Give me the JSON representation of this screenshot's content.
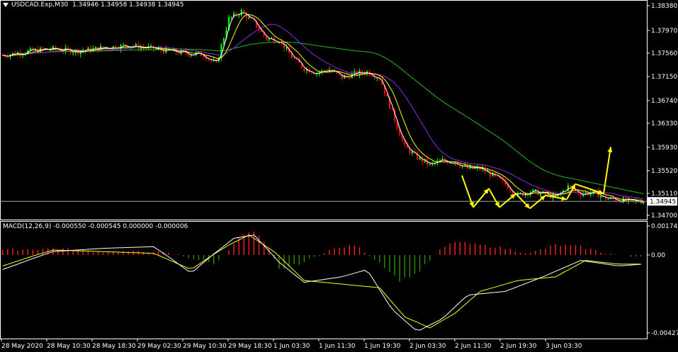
{
  "header": {
    "symbol": "USDCAD.Exp,M30",
    "ohlc": "1.34946 1.34958 1.34938 1.34945"
  },
  "macd_header": "MACD(12,26,9) -0.000550 -0.000545 0.000000 -0.000006",
  "colors": {
    "background": "#000000",
    "bull_candle": "#00ff00",
    "bear_candle": "#ff0000",
    "ma_fast": "#ffff00",
    "ma_mid": "#8a2be2",
    "ma_slow": "#22b822",
    "macd_pos": "#ff2020",
    "macd_neg": "#2e8b00",
    "signal": "#ffff00",
    "macd_line": "#ffffff",
    "arrows": "#ffff00",
    "grid": "#ffffff"
  },
  "chart_data": [
    {
      "type": "candlestick",
      "title": "USDCAD.Exp,M30",
      "y_ticks": [
        "1.38380",
        "1.37970",
        "1.37560",
        "1.37150",
        "1.36740",
        "1.36330",
        "1.35930",
        "1.35520",
        "1.35110",
        "1.34700"
      ],
      "ylim": [
        1.347,
        1.3838
      ],
      "current_price": "1.34945",
      "x_ticks": [
        "28 May 2020",
        "28 May 10:30",
        "28 May 18:30",
        "29 May 02:30",
        "29 May 10:30",
        "29 May 18:30",
        "1 Jun 03:30",
        "1 Jun 11:30",
        "1 Jun 19:30",
        "2 Jun 03:30",
        "2 Jun 11:30",
        "2 Jun 19:30",
        "3 Jun 03:30"
      ],
      "price_path": [
        [
          0,
          1.3751
        ],
        [
          10,
          1.3758
        ],
        [
          20,
          1.3762
        ],
        [
          30,
          1.3758
        ],
        [
          40,
          1.3764
        ],
        [
          50,
          1.3768
        ],
        [
          60,
          1.3762
        ],
        [
          70,
          1.3756
        ],
        [
          80,
          1.3752
        ],
        [
          85,
          1.3735
        ],
        [
          90,
          1.3815
        ],
        [
          95,
          1.3828
        ],
        [
          100,
          1.3808
        ],
        [
          105,
          1.378
        ],
        [
          110,
          1.3778
        ],
        [
          115,
          1.3748
        ],
        [
          120,
          1.3728
        ],
        [
          125,
          1.372
        ],
        [
          130,
          1.3726
        ],
        [
          135,
          1.3712
        ],
        [
          140,
          1.3718
        ],
        [
          145,
          1.3722
        ],
        [
          150,
          1.3712
        ],
        [
          155,
          1.365
        ],
        [
          160,
          1.359
        ],
        [
          165,
          1.3572
        ],
        [
          170,
          1.3558
        ],
        [
          175,
          1.3566
        ],
        [
          180,
          1.3564
        ],
        [
          185,
          1.3552
        ],
        [
          190,
          1.3552
        ],
        [
          195,
          1.354
        ],
        [
          200,
          1.3525
        ],
        [
          205,
          1.3505
        ],
        [
          210,
          1.3512
        ],
        [
          215,
          1.3508
        ],
        [
          220,
          1.3502
        ],
        [
          225,
          1.352
        ],
        [
          230,
          1.3508
        ],
        [
          235,
          1.351
        ],
        [
          240,
          1.35
        ],
        [
          245,
          1.3498
        ],
        [
          250,
          1.3494
        ],
        [
          255,
          1.3495
        ]
      ],
      "n_bars": 256,
      "arrow_forecast": [
        [
          1.354,
          1.3484
        ],
        [
          1.3484,
          1.3517
        ],
        [
          1.3517,
          1.3484
        ],
        [
          1.3484,
          1.3508
        ],
        [
          1.3508,
          1.3482
        ],
        [
          1.3482,
          1.3505
        ],
        [
          1.3505,
          1.3498
        ],
        [
          1.3498,
          1.3525
        ],
        [
          1.3525,
          1.3508
        ],
        [
          1.3508,
          1.359
        ]
      ]
    },
    {
      "type": "macd",
      "title": "MACD(12,26,9)",
      "y_ticks": [
        "0.001745",
        "0.00",
        "-0.004277"
      ],
      "ylim": [
        -0.004277,
        0.001745
      ],
      "histogram_path": [
        [
          0,
          0.0003
        ],
        [
          20,
          0.0004
        ],
        [
          40,
          0.0002
        ],
        [
          60,
          0.0002
        ],
        [
          70,
          0.0
        ],
        [
          85,
          -0.0005
        ],
        [
          95,
          0.0012
        ],
        [
          100,
          0.0014
        ],
        [
          105,
          0.0006
        ],
        [
          110,
          -0.0008
        ],
        [
          120,
          -0.0004
        ],
        [
          130,
          0.0003
        ],
        [
          140,
          0.0006
        ],
        [
          150,
          -0.0004
        ],
        [
          158,
          -0.0014
        ],
        [
          165,
          -0.001
        ],
        [
          175,
          0.0004
        ],
        [
          180,
          0.0008
        ],
        [
          190,
          0.0006
        ],
        [
          200,
          0.0004
        ],
        [
          210,
          0.0001
        ],
        [
          220,
          0.0006
        ],
        [
          230,
          0.0005
        ],
        [
          240,
          0.0001
        ],
        [
          250,
          -0.0001
        ],
        [
          255,
          -1e-05
        ]
      ],
      "signal_path": [
        [
          0,
          -0.0006
        ],
        [
          20,
          0.0003
        ],
        [
          40,
          0.0002
        ],
        [
          60,
          0.0001
        ],
        [
          75,
          -0.0008
        ],
        [
          90,
          0.0006
        ],
        [
          98,
          0.0012
        ],
        [
          108,
          0.0002
        ],
        [
          120,
          -0.0014
        ],
        [
          135,
          -0.0016
        ],
        [
          150,
          -0.0018
        ],
        [
          160,
          -0.0034
        ],
        [
          170,
          -0.004
        ],
        [
          180,
          -0.0032
        ],
        [
          190,
          -0.002
        ],
        [
          205,
          -0.0014
        ],
        [
          220,
          -0.0012
        ],
        [
          232,
          -0.0003
        ],
        [
          245,
          -0.0005
        ],
        [
          255,
          -0.0005
        ]
      ],
      "macd_line_path": [
        [
          0,
          -0.0008
        ],
        [
          20,
          0.0002
        ],
        [
          40,
          0.0004
        ],
        [
          60,
          0.0005
        ],
        [
          75,
          -0.001
        ],
        [
          92,
          0.001
        ],
        [
          100,
          0.0012
        ],
        [
          110,
          -0.0004
        ],
        [
          120,
          -0.0015
        ],
        [
          135,
          -0.0012
        ],
        [
          145,
          -0.0008
        ],
        [
          155,
          -0.003
        ],
        [
          165,
          -0.0042
        ],
        [
          175,
          -0.0035
        ],
        [
          185,
          -0.0022
        ],
        [
          200,
          -0.002
        ],
        [
          215,
          -0.0012
        ],
        [
          230,
          -0.0003
        ],
        [
          245,
          -0.0006
        ],
        [
          255,
          -0.0005
        ]
      ]
    }
  ]
}
